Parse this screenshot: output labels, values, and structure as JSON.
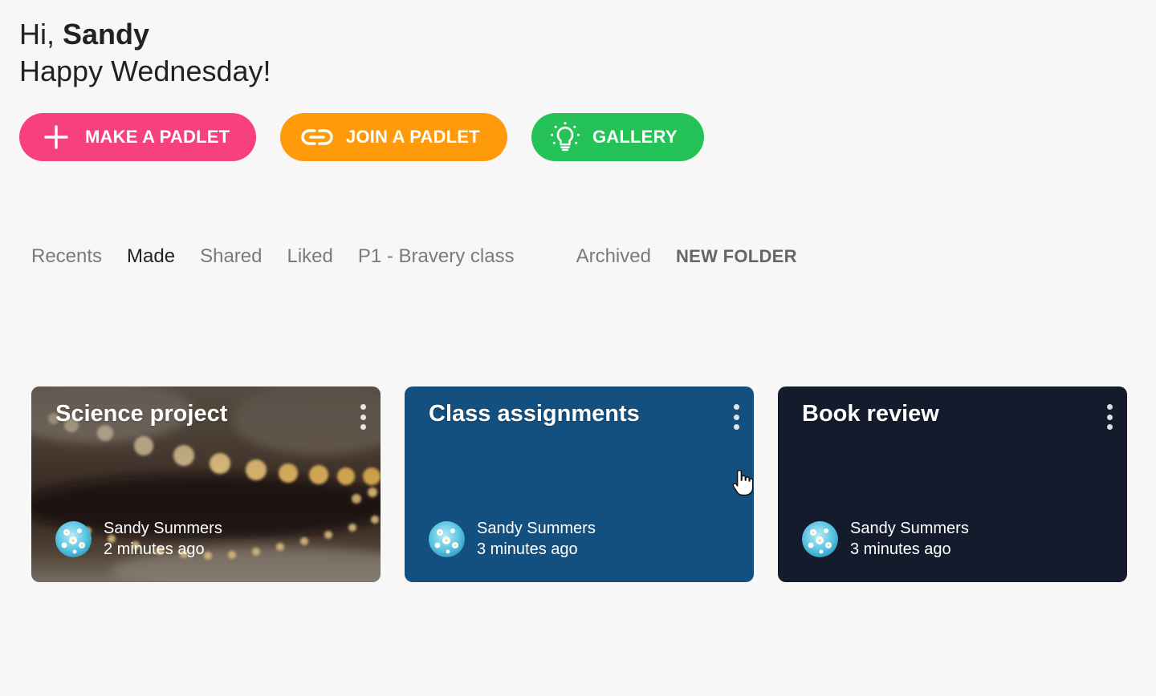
{
  "greeting": {
    "prefix": "Hi, ",
    "name": "Sandy",
    "subtitle": "Happy Wednesday!"
  },
  "actions": {
    "make": {
      "label": "MAKE A PADLET",
      "icon": "plus-icon",
      "color": "#f7417f"
    },
    "join": {
      "label": "JOIN A PADLET",
      "icon": "link-icon",
      "color": "#ff9a0a"
    },
    "gallery": {
      "label": "GALLERY",
      "icon": "lightbulb-icon",
      "color": "#24c257"
    }
  },
  "tabs": {
    "items": [
      "Recents",
      "Made",
      "Shared",
      "Liked",
      "P1 - Bravery class",
      "Archived"
    ],
    "active": "Made",
    "new_folder": "NEW FOLDER"
  },
  "cards": [
    {
      "title": "Science project",
      "author": "Sandy Summers",
      "time": "2 minutes ago",
      "background": "bokeh-photo"
    },
    {
      "title": "Class assignments",
      "author": "Sandy Summers",
      "time": "3 minutes ago",
      "background": "#14507f"
    },
    {
      "title": "Book review",
      "author": "Sandy Summers",
      "time": "3 minutes ago",
      "background": "#141b2d"
    }
  ]
}
